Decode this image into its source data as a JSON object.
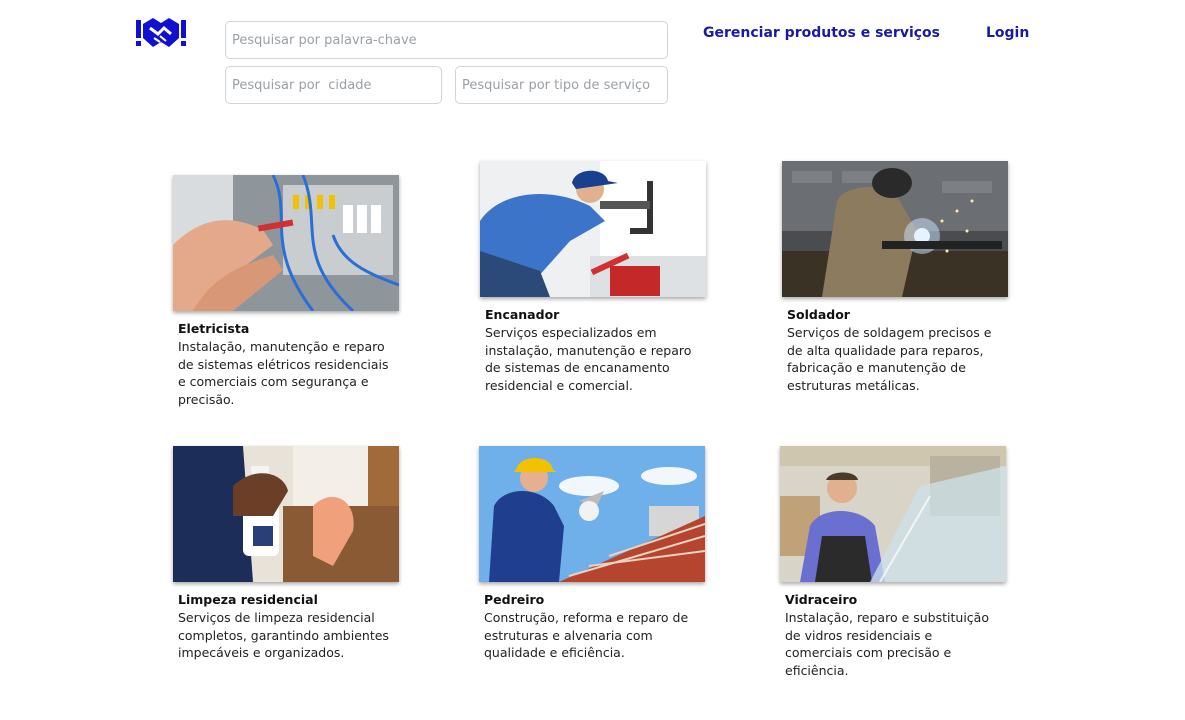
{
  "header": {
    "logo_icon": "handshake-icon",
    "brand_color": "#1010d0",
    "nav": {
      "manage_label": "Gerenciar produtos e serviços",
      "login_label": "Login"
    }
  },
  "search": {
    "keyword_placeholder": "Pesquisar por palavra-chave",
    "city_placeholder": "Pesquisar por  cidade",
    "type_placeholder": "Pesquisar por tipo de serviço"
  },
  "services": [
    {
      "title": "Eletricista",
      "description": "Instalação, manutenção e reparo de sistemas elétricos residenciais e comerciais com segurança e precisão.",
      "image": "electrician-photo"
    },
    {
      "title": "Encanador",
      "description": "Serviços especializados em instalação, manutenção e reparo de sistemas de encanamento residencial e comercial.",
      "image": "plumber-photo"
    },
    {
      "title": "Soldador",
      "description": "Serviços de soldagem precisos e de alta qualidade para reparos, fabricação e manutenção de estruturas metálicas.",
      "image": "welder-photo"
    },
    {
      "title": "Limpeza residencial",
      "description": "Serviços de limpeza residencial completos, garantindo ambientes impecáveis e organizados.",
      "image": "cleaning-photo"
    },
    {
      "title": "Pedreiro",
      "description": "Construção, reforma e reparo de estruturas e alvenaria com qualidade e eficiência.",
      "image": "bricklayer-photo"
    },
    {
      "title": "Vidraceiro",
      "description": "Instalação, reparo e substituição de vidros residenciais e comerciais com precisão e eficiência.",
      "image": "glazier-photo"
    }
  ]
}
